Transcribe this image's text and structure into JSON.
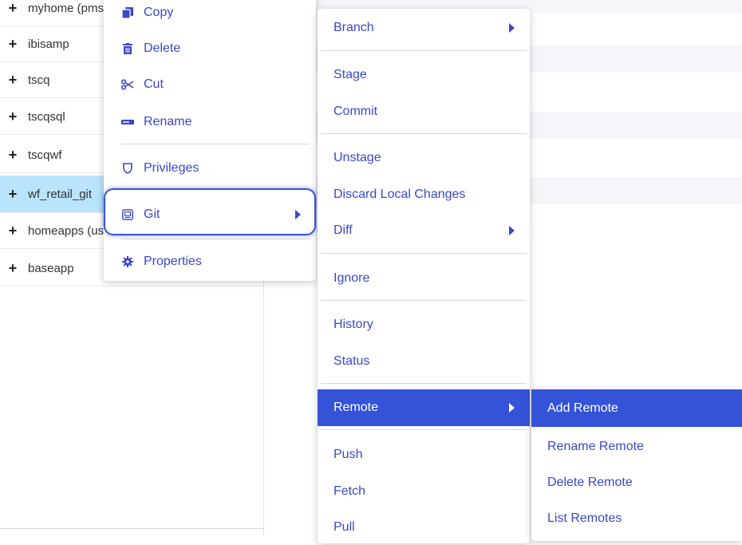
{
  "tree": {
    "items": [
      {
        "label": "myhome (pms"
      },
      {
        "label": "ibisamp"
      },
      {
        "label": "tscq"
      },
      {
        "label": "tscqsql"
      },
      {
        "label": "tscqwf"
      },
      {
        "label": "wf_retail_git"
      },
      {
        "label": "homeapps (us"
      },
      {
        "label": "baseapp"
      }
    ],
    "expand_glyph": "+",
    "selected_item": "wf_retail_git"
  },
  "context_menu": {
    "items": [
      {
        "label": "Copy",
        "icon": "copy-icon"
      },
      {
        "label": "Delete",
        "icon": "trash-icon"
      },
      {
        "label": "Cut",
        "icon": "scissors-icon"
      },
      {
        "label": "Rename",
        "icon": "rename-icon"
      },
      {
        "label": "Privileges",
        "icon": "shield-icon"
      },
      {
        "label": "Git",
        "icon": "git-icon"
      },
      {
        "label": "Properties",
        "icon": "gear-icon"
      }
    ]
  },
  "git_menu": {
    "items": [
      {
        "label": "Branch"
      },
      {
        "label": "Stage"
      },
      {
        "label": "Commit"
      },
      {
        "label": "Unstage"
      },
      {
        "label": "Discard Local Changes"
      },
      {
        "label": "Diff"
      },
      {
        "label": "Ignore"
      },
      {
        "label": "History"
      },
      {
        "label": "Status"
      },
      {
        "label": "Remote"
      },
      {
        "label": "Push"
      },
      {
        "label": "Fetch"
      },
      {
        "label": "Pull"
      }
    ]
  },
  "remote_menu": {
    "items": [
      {
        "label": "Add Remote"
      },
      {
        "label": "Rename Remote"
      },
      {
        "label": "Delete Remote"
      },
      {
        "label": "List Remotes"
      }
    ]
  },
  "colors": {
    "accent": "#3553d8",
    "menu_text": "#3a47c8",
    "selected_row": "#b9e4fb",
    "highlight_ring": "#3a55d9"
  }
}
